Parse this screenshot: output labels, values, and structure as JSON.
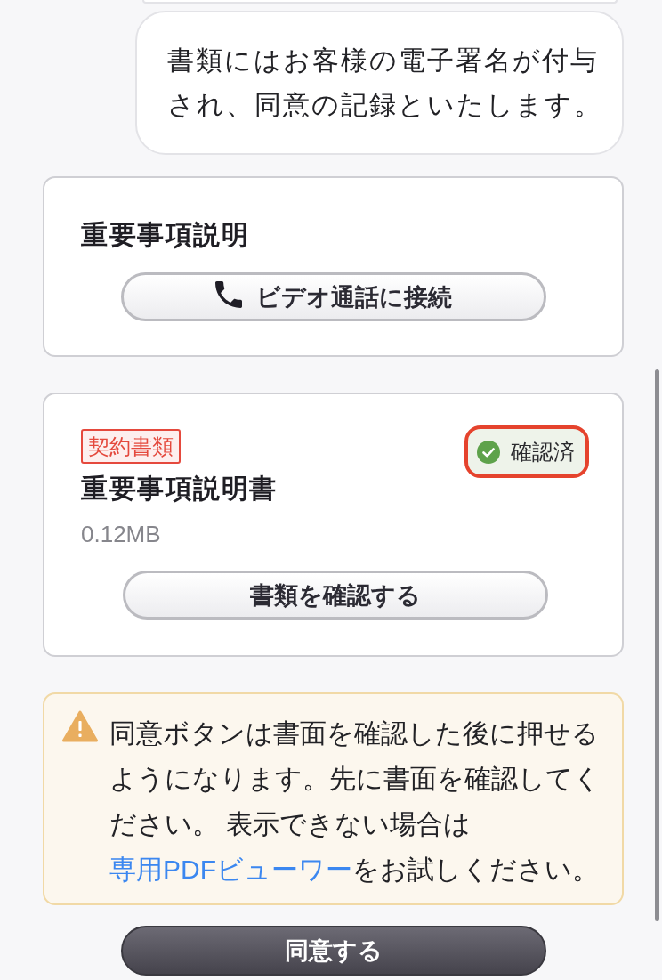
{
  "message": {
    "text": "書類にはお客様の電子署名が付与され、同意の記録といたします。"
  },
  "explanation_card": {
    "title": "重要事項説明",
    "button": {
      "label": "ビデオ通話に接続"
    }
  },
  "document_card": {
    "tag": "契約書類",
    "status": {
      "label": "確認済",
      "done": true,
      "outlined": true
    },
    "title": "重要事項説明書",
    "size": "0.12MB",
    "button": {
      "label": "書類を確認する"
    }
  },
  "notice": {
    "text_before": "同意ボタンは書面を確認した後に押せるようになります。先に書面を確認してください。 表示できない場合は",
    "link": "専用PDFビューワー",
    "text_after": "をお試しください。"
  },
  "agree_button": {
    "label": "同意する"
  }
}
